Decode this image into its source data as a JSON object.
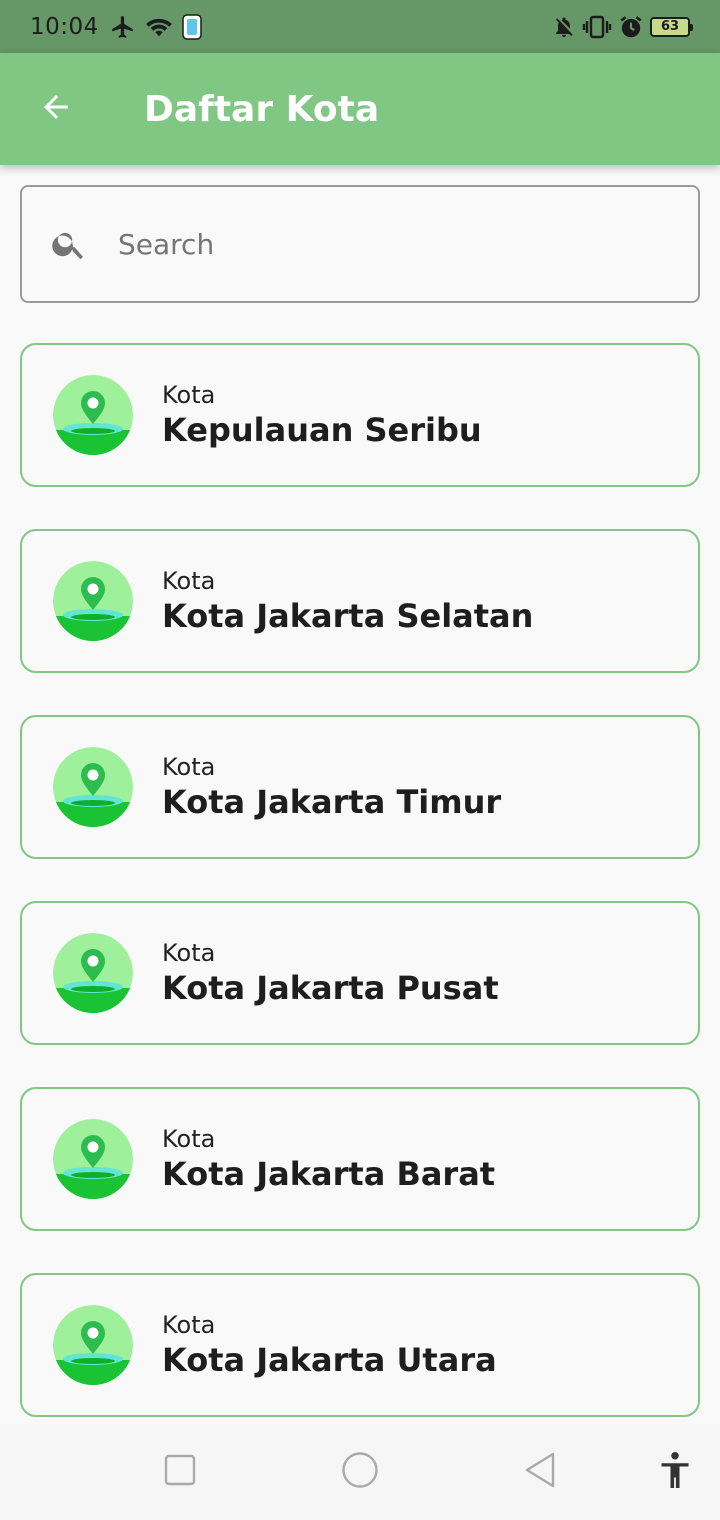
{
  "status_bar": {
    "time": "10:04",
    "battery_level": "63",
    "left_icons": [
      "airplane-icon",
      "wifi-icon",
      "phone-screen-icon"
    ],
    "right_icons": [
      "mute-bell-icon",
      "vibrate-icon",
      "alarm-icon",
      "battery-icon"
    ]
  },
  "app_bar": {
    "title": "Daftar Kota",
    "background": "#81c784"
  },
  "search": {
    "placeholder": "Search",
    "value": ""
  },
  "cities": [
    {
      "type": "Kota",
      "name": "Kepulauan Seribu"
    },
    {
      "type": "Kota",
      "name": "Kota Jakarta Selatan"
    },
    {
      "type": "Kota",
      "name": "Kota Jakarta Timur"
    },
    {
      "type": "Kota",
      "name": "Kota Jakarta Pusat"
    },
    {
      "type": "Kota",
      "name": "Kota Jakarta Barat"
    },
    {
      "type": "Kota",
      "name": "Kota Jakarta Utara"
    }
  ],
  "nav_bar": {
    "buttons": [
      "recents-square-icon",
      "home-circle-icon",
      "back-triangle-icon",
      "accessibility-icon"
    ]
  },
  "colors": {
    "accent": "#81c784",
    "status_bar": "#669766",
    "card_border": "#81c784"
  }
}
